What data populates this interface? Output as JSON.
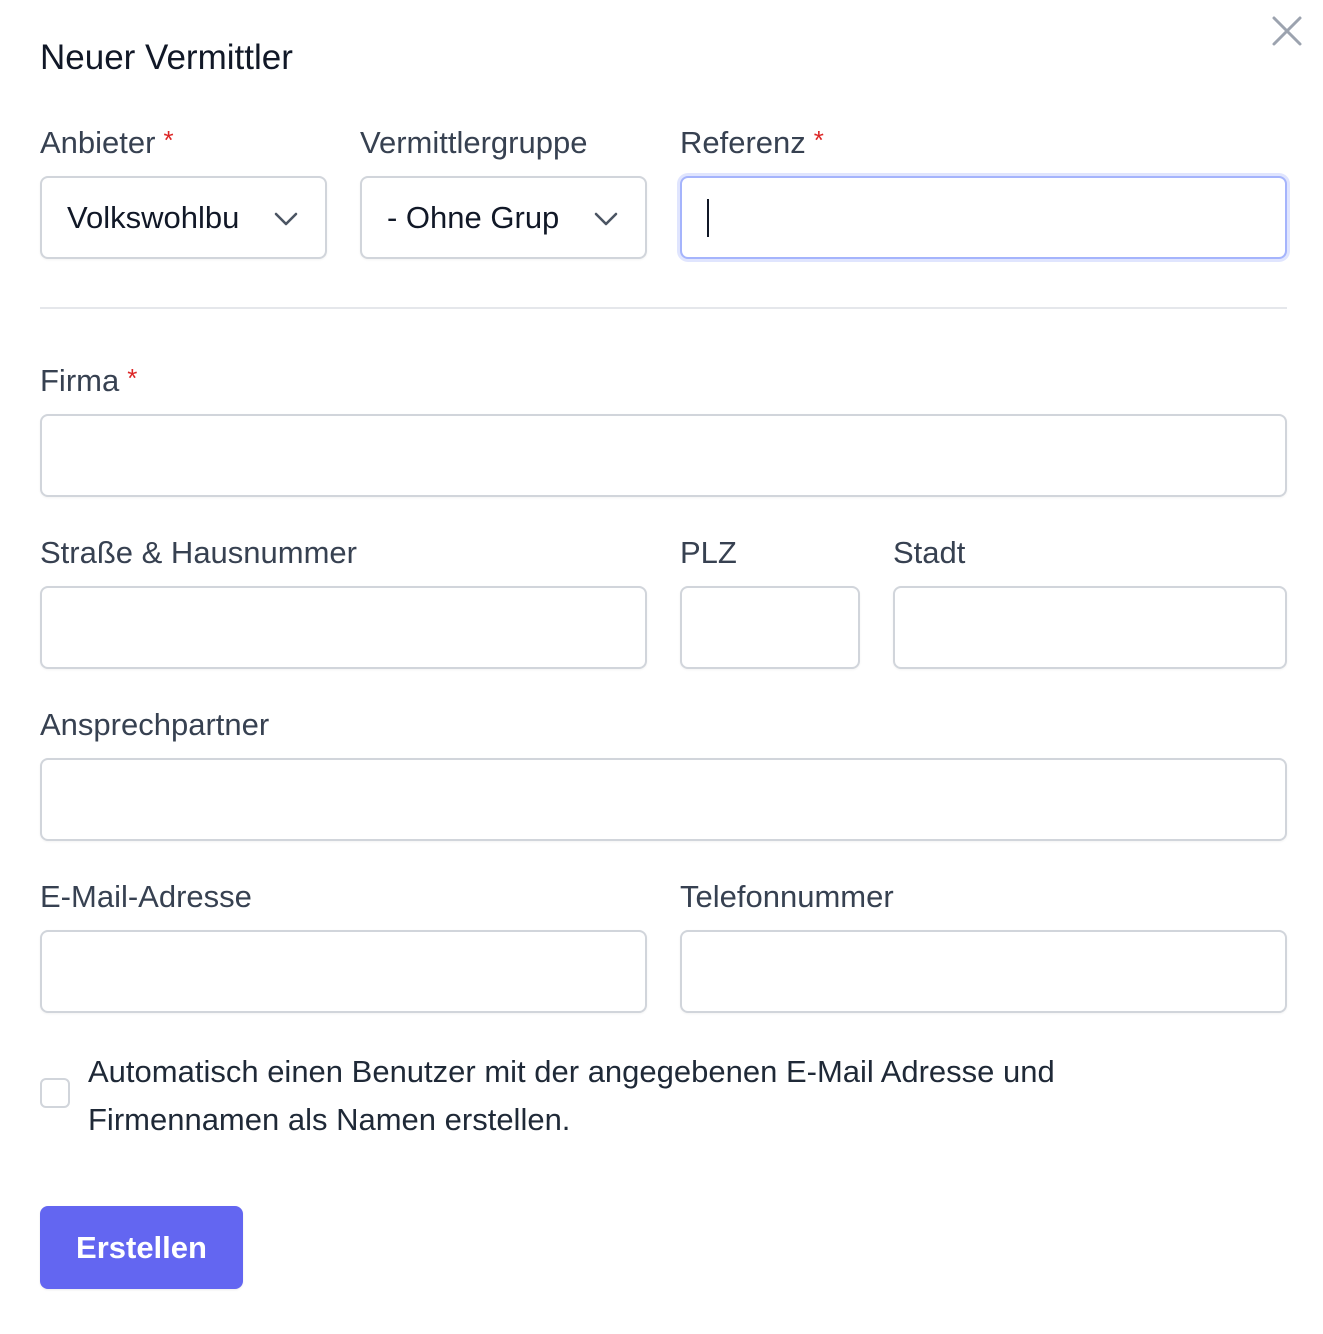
{
  "dialog": {
    "title": "Neuer Vermittler",
    "close_icon": "close-icon"
  },
  "required_marker": "*",
  "anbieter": {
    "label": "Anbieter",
    "value": "Volkswohlbu",
    "required": true
  },
  "vermittlergruppe": {
    "label": "Vermittlergruppe",
    "value": "- Ohne Grup"
  },
  "referenz": {
    "label": "Referenz",
    "value": "",
    "required": true,
    "focused": true
  },
  "firma": {
    "label": "Firma",
    "value": "",
    "required": true
  },
  "strasse": {
    "label": "Straße & Hausnummer",
    "value": ""
  },
  "plz": {
    "label": "PLZ",
    "value": ""
  },
  "stadt": {
    "label": "Stadt",
    "value": ""
  },
  "ansprechpartner": {
    "label": "Ansprechpartner",
    "value": ""
  },
  "email": {
    "label": "E-Mail-Adresse",
    "value": ""
  },
  "telefon": {
    "label": "Telefonnummer",
    "value": ""
  },
  "auto_user": {
    "checked": false,
    "label": "Automatisch einen Benutzer mit der angegebenen E-Mail Adresse und Firmennamen als Namen erstellen."
  },
  "submit": {
    "label": "Erstellen"
  },
  "colors": {
    "accent": "#6366f1",
    "required": "#dc2626",
    "focus_ring": "#a5b4fc",
    "border": "#d1d5db"
  }
}
